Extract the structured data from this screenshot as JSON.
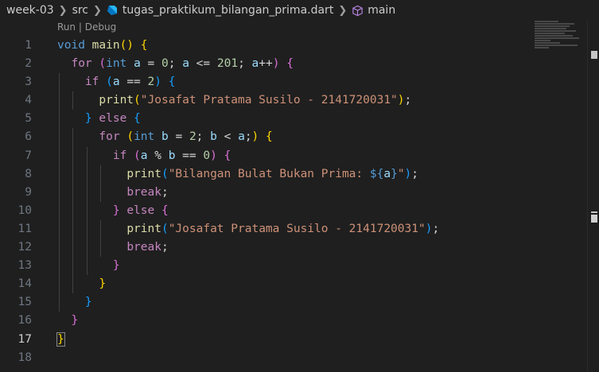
{
  "breadcrumb": {
    "folder1": "week-03",
    "folder2": "src",
    "file": "tugas_praktikum_bilangan_prima.dart",
    "symbol": "main"
  },
  "codelens": {
    "run": "Run",
    "separator": "|",
    "debug": "Debug"
  },
  "active_line": 17,
  "lines": [
    {
      "n": "1",
      "tokens": [
        [
          "kw",
          "void"
        ],
        [
          "",
          " "
        ],
        [
          "fn",
          "main"
        ],
        [
          "p1",
          "()"
        ],
        [
          "",
          " "
        ],
        [
          "p1",
          "{"
        ]
      ]
    },
    {
      "n": "2",
      "tokens": [
        [
          "",
          "  "
        ],
        [
          "ctl",
          "for"
        ],
        [
          "",
          " "
        ],
        [
          "p2",
          "("
        ],
        [
          "kw",
          "int"
        ],
        [
          "",
          " "
        ],
        [
          "var",
          "a"
        ],
        [
          "",
          " = "
        ],
        [
          "num",
          "0"
        ],
        [
          "",
          "; "
        ],
        [
          "var",
          "a"
        ],
        [
          "",
          " <= "
        ],
        [
          "num",
          "201"
        ],
        [
          "",
          "; "
        ],
        [
          "var",
          "a"
        ],
        [
          "",
          "++"
        ],
        [
          "p2",
          ")"
        ],
        [
          "",
          " "
        ],
        [
          "p2",
          "{"
        ]
      ]
    },
    {
      "n": "3",
      "tokens": [
        [
          "",
          "    "
        ],
        [
          "ctl",
          "if"
        ],
        [
          "",
          " "
        ],
        [
          "p3",
          "("
        ],
        [
          "var",
          "a"
        ],
        [
          "",
          " == "
        ],
        [
          "num",
          "2"
        ],
        [
          "p3",
          ")"
        ],
        [
          "",
          " "
        ],
        [
          "p3",
          "{"
        ]
      ]
    },
    {
      "n": "4",
      "tokens": [
        [
          "",
          "      "
        ],
        [
          "fn",
          "print"
        ],
        [
          "p1",
          "("
        ],
        [
          "str",
          "\"Josafat Pratama Susilo - 2141720031\""
        ],
        [
          "p1",
          ")"
        ],
        [
          "",
          ";"
        ]
      ]
    },
    {
      "n": "5",
      "tokens": [
        [
          "",
          "    "
        ],
        [
          "p3",
          "}"
        ],
        [
          "",
          " "
        ],
        [
          "ctl",
          "else"
        ],
        [
          "",
          " "
        ],
        [
          "p3",
          "{"
        ]
      ]
    },
    {
      "n": "6",
      "tokens": [
        [
          "",
          "      "
        ],
        [
          "ctl",
          "for"
        ],
        [
          "",
          " "
        ],
        [
          "p1",
          "("
        ],
        [
          "kw",
          "int"
        ],
        [
          "",
          " "
        ],
        [
          "var",
          "b"
        ],
        [
          "",
          " = "
        ],
        [
          "num",
          "2"
        ],
        [
          "",
          "; "
        ],
        [
          "var",
          "b"
        ],
        [
          "",
          " < "
        ],
        [
          "var",
          "a"
        ],
        [
          "",
          ";"
        ],
        [
          "p1",
          ")"
        ],
        [
          "",
          " "
        ],
        [
          "p1",
          "{"
        ]
      ]
    },
    {
      "n": "7",
      "tokens": [
        [
          "",
          "        "
        ],
        [
          "ctl",
          "if"
        ],
        [
          "",
          " "
        ],
        [
          "p2",
          "("
        ],
        [
          "var",
          "a"
        ],
        [
          "",
          " % "
        ],
        [
          "var",
          "b"
        ],
        [
          "",
          " == "
        ],
        [
          "num",
          "0"
        ],
        [
          "p2",
          ")"
        ],
        [
          "",
          " "
        ],
        [
          "p2",
          "{"
        ]
      ]
    },
    {
      "n": "8",
      "tokens": [
        [
          "",
          "          "
        ],
        [
          "fn",
          "print"
        ],
        [
          "p3",
          "("
        ],
        [
          "str",
          "\"Bilangan Bulat Bukan Prima: "
        ],
        [
          "interp",
          "${"
        ],
        [
          "var",
          "a"
        ],
        [
          "interp",
          "}"
        ],
        [
          "str",
          "\""
        ],
        [
          "p3",
          ")"
        ],
        [
          "",
          ";"
        ]
      ]
    },
    {
      "n": "9",
      "tokens": [
        [
          "",
          "          "
        ],
        [
          "ctl",
          "break"
        ],
        [
          "",
          ";"
        ]
      ]
    },
    {
      "n": "10",
      "tokens": [
        [
          "",
          "        "
        ],
        [
          "p2",
          "}"
        ],
        [
          "",
          " "
        ],
        [
          "ctl",
          "else"
        ],
        [
          "",
          " "
        ],
        [
          "p2",
          "{"
        ]
      ]
    },
    {
      "n": "11",
      "tokens": [
        [
          "",
          "          "
        ],
        [
          "fn",
          "print"
        ],
        [
          "p3",
          "("
        ],
        [
          "str",
          "\"Josafat Pratama Susilo - 2141720031\""
        ],
        [
          "p3",
          ")"
        ],
        [
          "",
          ";"
        ]
      ]
    },
    {
      "n": "12",
      "tokens": [
        [
          "",
          "          "
        ],
        [
          "ctl",
          "break"
        ],
        [
          "",
          ";"
        ]
      ]
    },
    {
      "n": "13",
      "tokens": [
        [
          "",
          "        "
        ],
        [
          "p2",
          "}"
        ]
      ]
    },
    {
      "n": "14",
      "tokens": [
        [
          "",
          "      "
        ],
        [
          "p1",
          "}"
        ]
      ]
    },
    {
      "n": "15",
      "tokens": [
        [
          "",
          "    "
        ],
        [
          "p3",
          "}"
        ]
      ]
    },
    {
      "n": "16",
      "tokens": [
        [
          "",
          "  "
        ],
        [
          "p2",
          "}"
        ]
      ]
    },
    {
      "n": "17",
      "tokens": [
        [
          "p1 brace-hl",
          "}"
        ]
      ]
    },
    {
      "n": "18",
      "tokens": []
    }
  ]
}
